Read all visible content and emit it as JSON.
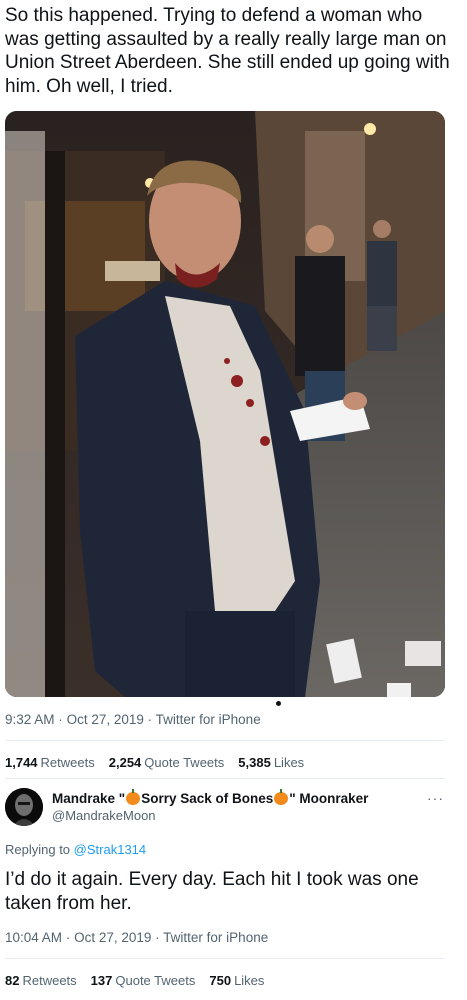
{
  "tweet": {
    "text": "So this happened. Trying to defend a woman who was getting assaulted by a really really large man on Union Street Aberdeen. She still ended up going with him. Oh well, I tried.",
    "time": "9:32 AM",
    "date": "Oct 27, 2019",
    "source": "Twitter for iPhone",
    "separator": "·",
    "stats": {
      "retweets_count": "1,744",
      "retweets_label": "Retweets",
      "quotes_count": "2,254",
      "quotes_label": "Quote Tweets",
      "likes_count": "5,385",
      "likes_label": "Likes"
    }
  },
  "reply": {
    "name_part1": "Mandrake \"",
    "name_part2": "Sorry Sack of Bones",
    "name_part3": "\" Moonraker",
    "handle": "@MandrakeMoon",
    "more": "···",
    "replying_prefix": "Replying to",
    "replying_to": "@Strak1314",
    "text": "I’d do it again. Every day. Each hit I took was one taken from her.",
    "time": "10:04 AM",
    "date": "Oct 27, 2019",
    "source": "Twitter for iPhone",
    "separator": "·",
    "stats": {
      "retweets_count": "82",
      "retweets_label": "Retweets",
      "quotes_count": "137",
      "quotes_label": "Quote Tweets",
      "likes_count": "750",
      "likes_label": "Likes"
    }
  },
  "icons": {
    "pumpkin": "pumpkin-emoji-icon",
    "more": "more-options-icon"
  },
  "colors": {
    "link": "#1d9bf0",
    "secondary_text": "#536471",
    "primary_text": "#0f1419"
  }
}
